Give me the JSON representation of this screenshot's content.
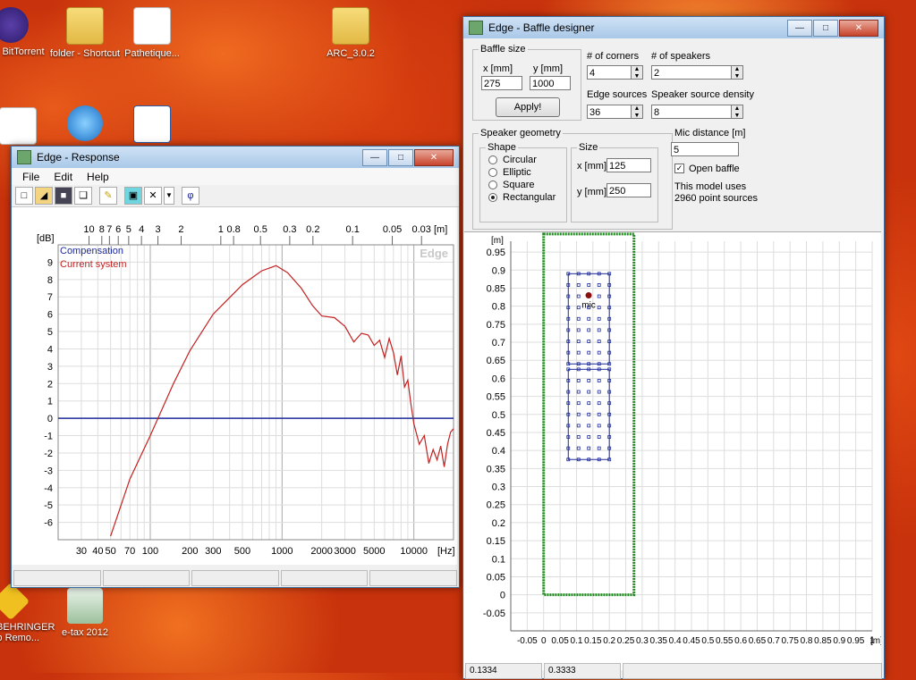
{
  "desktop": {
    "icons": [
      {
        "label": "BitTorrent",
        "kind": "app"
      },
      {
        "label": "folder - Shortcut",
        "kind": "folder"
      },
      {
        "label": "Pathetique...",
        "kind": "doc"
      },
      {
        "label": "ARC_3.0.2",
        "kind": "folder"
      },
      {
        "label": "e-tax 2012",
        "kind": "app"
      },
      {
        "label": "BEHRINGER Amp Remo...",
        "kind": "app"
      }
    ]
  },
  "response_window": {
    "title": "Edge - Response",
    "menu": [
      "File",
      "Edit",
      "Help"
    ],
    "watermark": "Edge",
    "legend": {
      "compensation": "Compensation",
      "current": "Current system"
    },
    "colors": {
      "compensation": "#1c2a9a",
      "current": "#c42020"
    },
    "chart_data": {
      "type": "line",
      "title": "",
      "xlabel": "[Hz]",
      "ylabel": "[dB]",
      "top_axis_label": "[m]",
      "x_scale": "log",
      "xlim": [
        20,
        20000
      ],
      "ylim": [
        -7,
        10
      ],
      "x_tick_labels": [
        "30",
        "40",
        "50",
        "70",
        "100",
        "200",
        "300",
        "500",
        "1000",
        "2000",
        "3000",
        "5000",
        "10000"
      ],
      "x_ticks": [
        30,
        40,
        50,
        70,
        100,
        200,
        300,
        500,
        1000,
        2000,
        3000,
        5000,
        10000
      ],
      "y_ticks": [
        9,
        8,
        7,
        6,
        5,
        4,
        3,
        2,
        1,
        0,
        -1,
        -2,
        -3,
        -4,
        -5,
        -6
      ],
      "top_tick_labels": [
        "10",
        "8",
        "7",
        "6",
        "5",
        "4",
        "3",
        "2",
        "1",
        "0.8",
        "0.5",
        "0.3",
        "0.2",
        "0.1",
        "0.05",
        "0.03"
      ],
      "grid": true,
      "series": [
        {
          "name": "Compensation",
          "x": [
            20,
            20000
          ],
          "y": [
            0,
            0
          ]
        },
        {
          "name": "Current system",
          "x": [
            50,
            70,
            100,
            150,
            200,
            300,
            500,
            700,
            900,
            1100,
            1400,
            1700,
            2000,
            2500,
            3000,
            3500,
            4000,
            4500,
            5000,
            5500,
            6000,
            6500,
            7000,
            7500,
            8000,
            8500,
            9000,
            9500,
            10000,
            11000,
            12000,
            13000,
            14000,
            15000,
            16000,
            17000,
            18000,
            19000,
            20000
          ],
          "y": [
            -6.8,
            -3.5,
            -1,
            2,
            3.9,
            6,
            7.7,
            8.5,
            8.8,
            8.4,
            7.5,
            6.5,
            5.9,
            5.8,
            5.3,
            4.4,
            4.9,
            4.8,
            4.2,
            4.5,
            3.5,
            4.6,
            3.8,
            2.5,
            3.6,
            1.8,
            2.2,
            0.8,
            -0.3,
            -1.5,
            -1,
            -2.6,
            -1.8,
            -2.4,
            -1.6,
            -2.8,
            -1.5,
            -0.8,
            -0.6
          ]
        }
      ]
    }
  },
  "baffle_window": {
    "title": "Edge - Baffle designer",
    "baffle_size": {
      "legend": "Baffle size",
      "x_label": "x [mm]",
      "y_label": "y [mm]",
      "x_value": "275",
      "y_value": "1000",
      "apply_label": "Apply!"
    },
    "corners": {
      "label": "# of corners",
      "value": "4"
    },
    "speakers": {
      "label": "# of speakers",
      "value": "2"
    },
    "edge_sources": {
      "label": "Edge sources",
      "value": "36"
    },
    "density": {
      "label": "Speaker source density",
      "value": "8"
    },
    "geometry": {
      "legend": "Speaker geometry",
      "shape_legend": "Shape",
      "shapes": [
        "Circular",
        "Elliptic",
        "Square",
        "Rectangular"
      ],
      "selected": "Rectangular"
    },
    "size": {
      "legend": "Size",
      "x_label": "x [mm]",
      "x_value": "125",
      "y_label": "y [mm]",
      "y_value": "250"
    },
    "mic": {
      "label": "Mic distance [m]",
      "value": "5",
      "open_baffle_label": "Open baffle",
      "open_baffle_checked": true
    },
    "info": {
      "line1": "This model uses",
      "line2": "2960 point sources"
    },
    "plot": {
      "y_unit": "[m]",
      "x_unit": "[m]",
      "mic_label": "mic",
      "x_ticks": [
        "-0.05",
        "0",
        "0.05",
        "0.1",
        "0.15",
        "0.2",
        "0.25",
        "0.3",
        "0.35",
        "0.4",
        "0.45",
        "0.5",
        "0.55",
        "0.6",
        "0.65",
        "0.7",
        "0.75",
        "0.8",
        "0.85",
        "0.9",
        "0.95",
        "1"
      ],
      "y_ticks": [
        "0.95",
        "0.9",
        "0.85",
        "0.8",
        "0.75",
        "0.7",
        "0.65",
        "0.6",
        "0.55",
        "0.5",
        "0.45",
        "0.4",
        "0.35",
        "0.3",
        "0.25",
        "0.2",
        "0.15",
        "0.1",
        "0.05",
        "0",
        "-0.05"
      ],
      "baffle_color": "#1d8a1d",
      "speaker_color": "#1c2a9a",
      "mic_color": "#8a1010",
      "baffle": {
        "x0": 0,
        "x1": 0.275,
        "y0": 0,
        "y1": 1.0
      },
      "speakers": [
        {
          "x0": 0.075,
          "x1": 0.2,
          "y0": 0.375,
          "y1": 0.625
        },
        {
          "x0": 0.075,
          "x1": 0.2,
          "y0": 0.64,
          "y1": 0.89
        }
      ],
      "mic_pos": {
        "x": 0.137,
        "y": 0.83
      }
    },
    "status": [
      "0.1334",
      "0.3333"
    ]
  }
}
